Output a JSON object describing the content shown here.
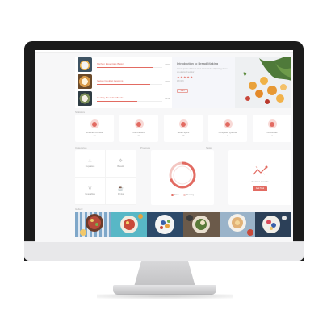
{
  "hero": {
    "courses": [
      {
        "title": "Kitchen Essentials Basics",
        "pct": "40%",
        "progress": 0.85,
        "thumb_color": "#3e5363"
      },
      {
        "title": "Vegan Cooking Lessons",
        "pct": "40%",
        "progress": 0.82,
        "thumb_color": "#d89a4a"
      },
      {
        "title": "Healthy Breakfast Bowls",
        "pct": "40%",
        "progress": 0.62,
        "thumb_color": "#2f3d44"
      }
    ],
    "featured": {
      "title": "Introduction to Bread Making",
      "description": "Lorem ipsum dolor sit amet consectetur adipiscing elit sed do eiusmod tempor",
      "stars": "★★★★★",
      "meta": "4.8 (12)",
      "button": "Start"
    }
  },
  "sections": {
    "statistics": "Statistics",
    "categories": "Categories",
    "progress": "Progress",
    "tasks": "Tasks",
    "gallery": "Gallery"
  },
  "stats": [
    {
      "label": "Finished Courses",
      "value": "12"
    },
    {
      "label": "Total Lessons",
      "value": "34"
    },
    {
      "label": "Hours Spent",
      "value": "48"
    },
    {
      "label": "Completed Quizzes",
      "value": "9"
    },
    {
      "label": "Certificates",
      "value": "3"
    }
  ],
  "categories": [
    {
      "label": "Cupcakes",
      "icon": "cupcake-icon",
      "glyph": "♨"
    },
    {
      "label": "Breads",
      "icon": "bread-icon",
      "glyph": "❖"
    },
    {
      "label": "Vegetables",
      "icon": "leaf-icon",
      "glyph": "❦"
    },
    {
      "label": "Drinks",
      "icon": "cup-icon",
      "glyph": "☕"
    }
  ],
  "ring": {
    "completed_fraction": 0.7,
    "legend": [
      "Done",
      "Pending"
    ],
    "colors": {
      "done": "#e26b62",
      "pending": "#f3c6c1"
    }
  },
  "tasks": {
    "empty_text": "You have no tasks",
    "button": "Add Task"
  },
  "gallery": [
    {
      "icon": "dish-icon",
      "bg": "#7fa7c9"
    },
    {
      "icon": "dish-icon",
      "bg": "#58b7c6"
    },
    {
      "icon": "dish-icon",
      "bg": "#2d4a6a"
    },
    {
      "icon": "dish-icon",
      "bg": "#6b5a4a"
    },
    {
      "icon": "dish-icon",
      "bg": "#9ab3c9"
    },
    {
      "icon": "dish-icon",
      "bg": "#2c4058"
    }
  ],
  "colors": {
    "accent": "#e26b62",
    "bezel": "#1b1b1b"
  }
}
